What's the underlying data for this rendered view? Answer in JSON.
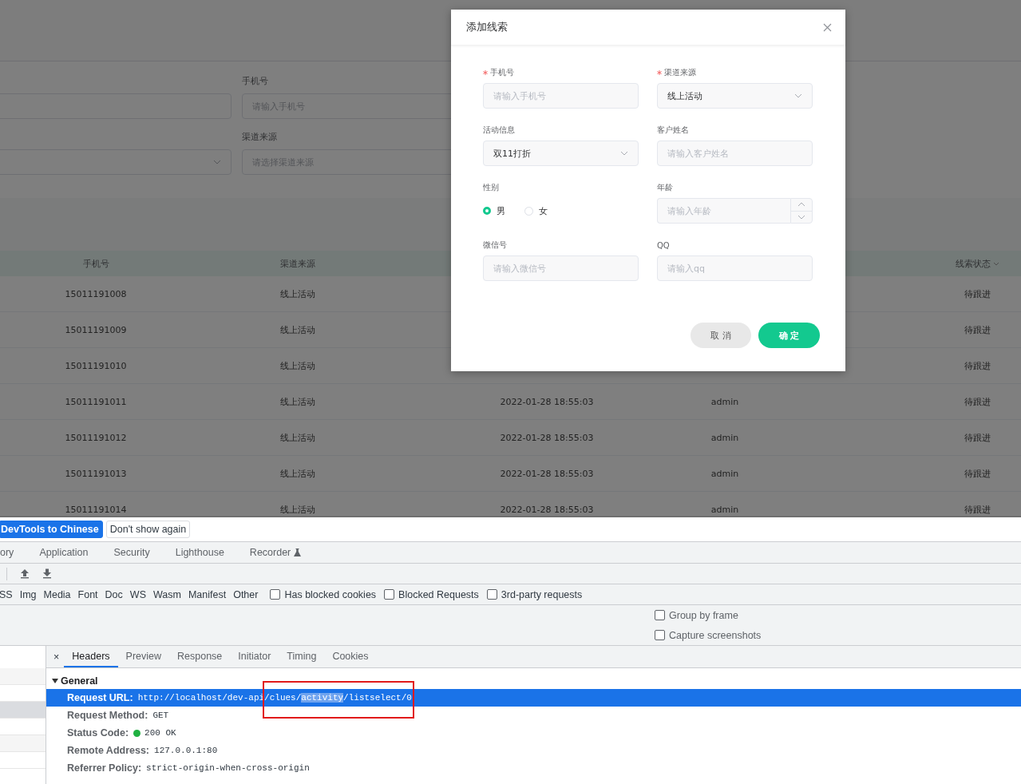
{
  "app": {
    "filters": [
      {
        "kind": "input"
      },
      {
        "kind": "input",
        "label": "手机号",
        "placeholder": "请输入手机号"
      },
      {
        "kind": "select"
      },
      {
        "kind": "select",
        "label": "渠道来源",
        "placeholder": "请选择渠道来源"
      }
    ],
    "table": {
      "header": {
        "phone": "手机号",
        "channel": "渠道来源",
        "status": "线索状态"
      },
      "rows": [
        {
          "phone": "15011191008",
          "channel": "线上活动",
          "status": "待跟进"
        },
        {
          "phone": "15011191009",
          "channel": "线上活动",
          "status": "待跟进"
        },
        {
          "phone": "15011191010",
          "channel": "线上活动",
          "status": "待跟进"
        },
        {
          "phone": "15011191011",
          "channel": "线上活动",
          "column_3": "2022-01-28 18:55:03",
          "column_4": "admin",
          "status": "待跟进"
        },
        {
          "phone": "15011191012",
          "channel": "线上活动",
          "column_3": "2022-01-28 18:55:03",
          "column_4": "admin",
          "status": "待跟进"
        },
        {
          "phone": "15011191013",
          "channel": "线上活动",
          "column_3": "2022-01-28 18:55:03",
          "column_4": "admin",
          "status": "待跟进"
        },
        {
          "phone": "15011191014",
          "channel": "线上活动",
          "column_3": "2022-01-28 18:55:03",
          "column_4": "admin",
          "status": "待跟进"
        }
      ]
    }
  },
  "dialog": {
    "title": "添加线索",
    "fields": [
      {
        "kind": "input",
        "label": "手机号",
        "required": true,
        "placeholder": "请输入手机号"
      },
      {
        "kind": "select",
        "label": "渠道来源",
        "required": true,
        "value": "线上活动"
      },
      {
        "kind": "select",
        "label": "活动信息",
        "required": false,
        "value": "双11打折"
      },
      {
        "kind": "input",
        "label": "客户姓名",
        "required": false,
        "placeholder": "请输入客户姓名"
      },
      {
        "kind": "radio",
        "label": "性别",
        "required": false,
        "options": [
          {
            "label": "男",
            "selected": true
          },
          {
            "label": "女",
            "selected": false
          }
        ]
      },
      {
        "kind": "number",
        "label": "年龄",
        "required": false,
        "placeholder": "请输入年龄"
      },
      {
        "kind": "input",
        "label": "微信号",
        "required": false,
        "placeholder": "请输入微信号"
      },
      {
        "kind": "input",
        "label": "QQ",
        "required": false,
        "placeholder": "请输入qq"
      }
    ],
    "buttons": [
      {
        "label": "取 消",
        "kind": "default"
      },
      {
        "label": "确 定",
        "kind": "primary"
      }
    ]
  },
  "devtools": {
    "banner_buttons": [
      {
        "label": "DevTools to Chinese",
        "kind": "primary"
      },
      {
        "label": "Don't show again",
        "kind": "default"
      }
    ],
    "panel_tabs": [
      {
        "label": "ory",
        "experimental": false
      },
      {
        "label": "Application",
        "experimental": false
      },
      {
        "label": "Security",
        "experimental": false
      },
      {
        "label": "Lighthouse",
        "experimental": false
      },
      {
        "label": "Recorder",
        "experimental": true
      }
    ],
    "type_filters": [
      "SS",
      "Img",
      "Media",
      "Font",
      "Doc",
      "WS",
      "Wasm",
      "Manifest",
      "Other"
    ],
    "filter_checkboxes": [
      {
        "label": "Has blocked cookies",
        "checked": false
      },
      {
        "label": "Blocked Requests",
        "checked": false
      },
      {
        "label": "3rd-party requests",
        "checked": false
      }
    ],
    "settings": [
      {
        "label": "Group by frame",
        "checked": false
      },
      {
        "label": "Capture screenshots",
        "checked": false
      }
    ],
    "request_rows": [
      {
        "selected": false
      },
      {
        "selected": false
      },
      {
        "selected": true
      },
      {
        "selected": false
      },
      {
        "selected": false
      },
      {
        "selected": false
      }
    ],
    "detail_close": "×",
    "detail_tabs": [
      {
        "label": "Headers",
        "selected": true
      },
      {
        "label": "Preview",
        "selected": false
      },
      {
        "label": "Response",
        "selected": false
      },
      {
        "label": "Initiator",
        "selected": false
      },
      {
        "label": "Timing",
        "selected": false
      },
      {
        "label": "Cookies",
        "selected": false
      }
    ],
    "general": {
      "title": "General",
      "expanded": true,
      "rows": [
        {
          "name": "Request URL:",
          "selected": true,
          "value": [
            {
              "text": "http://localhost/dev-api/clues/",
              "highlighted": false
            },
            {
              "text": "activity",
              "highlighted": true
            },
            {
              "text": "/listselect/0",
              "highlighted": false
            }
          ]
        },
        {
          "name": "Request Method:",
          "selected": false,
          "value": [
            {
              "text": "GET",
              "highlighted": false
            }
          ]
        },
        {
          "name": "Status Code:",
          "selected": false,
          "color": "#1fb141",
          "value": [
            {
              "text": "200 OK",
              "highlighted": false
            }
          ]
        },
        {
          "name": "Remote Address:",
          "selected": false,
          "value": [
            {
              "text": "127.0.0.1:80",
              "highlighted": false
            }
          ]
        },
        {
          "name": "Referrer Policy:",
          "selected": false,
          "value": [
            {
              "text": "strict-origin-when-cross-origin",
              "highlighted": false
            }
          ]
        }
      ]
    }
  }
}
